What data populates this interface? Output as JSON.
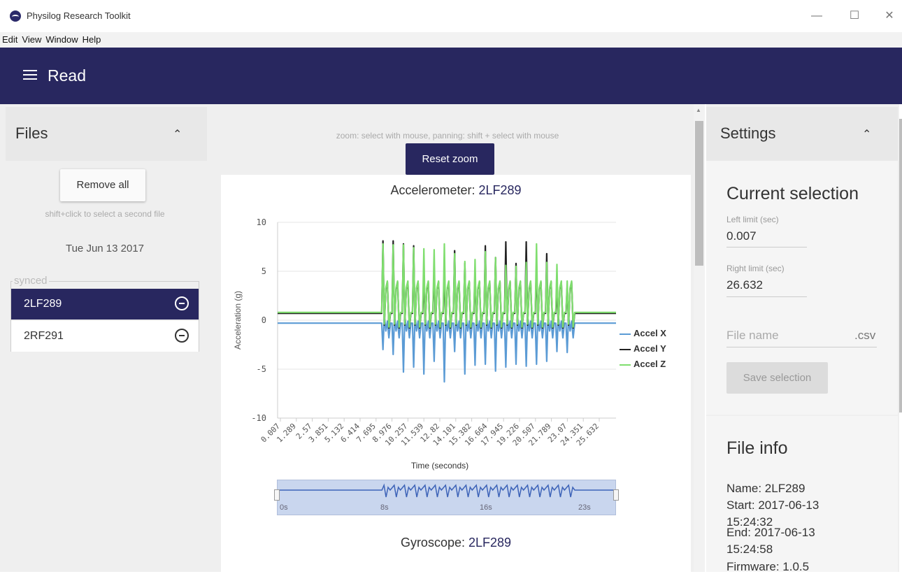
{
  "window": {
    "title": "Physilog Research Toolkit",
    "min": "—",
    "max": "☐",
    "close": "✕"
  },
  "menu": [
    "Edit",
    "View",
    "Window",
    "Help"
  ],
  "appbar": {
    "title": "Read"
  },
  "files": {
    "title": "Files",
    "remove_all": "Remove all",
    "hint": "shift+click to select a second file",
    "date": "Tue Jun 13 2017",
    "group_label": "synced",
    "items": [
      {
        "name": "2LF289"
      },
      {
        "name": "2RF291"
      }
    ]
  },
  "chart_area": {
    "zoom_hint": "zoom: select with mouse, panning: shift + select with mouse",
    "reset_zoom": "Reset zoom",
    "accel_title_a": "Accelerometer: ",
    "accel_title_b": "2LF289",
    "gyro_title_a": "Gyroscope: ",
    "gyro_title_b": "2LF289",
    "navigator_labels": [
      "0s",
      "8s",
      "16s",
      "23s"
    ]
  },
  "chart_data": {
    "type": "line",
    "title": "Accelerometer: 2LF289",
    "xlabel": "Time (seconds)",
    "ylabel": "Acceleration (g)",
    "ylim": [
      -10,
      10
    ],
    "yticks": [
      10,
      5,
      0,
      -5,
      -10
    ],
    "xlim": [
      0.007,
      26.632
    ],
    "xticks": [
      "0.007",
      "1.289",
      "2.57",
      "3.851",
      "5.132",
      "6.414",
      "7.695",
      "8.976",
      "10.257",
      "11.539",
      "12.82",
      "14.101",
      "15.382",
      "16.664",
      "17.945",
      "19.226",
      "20.507",
      "21.789",
      "23.07",
      "24.351",
      "25.632"
    ],
    "series": [
      {
        "name": "Accel X",
        "color": "#5b9bd5",
        "baseline": -0.3,
        "peaks": [
          -3,
          -3.5,
          -5.3,
          -4.8,
          -5.5,
          -4.2,
          -6.3,
          -3.2,
          -5.5,
          -4.6,
          -4.5,
          -5.2,
          -4.8,
          -4.5,
          -4.7,
          -4.5,
          -4.2,
          -3.2,
          -3.3
        ]
      },
      {
        "name": "Accel Y",
        "color": "#222222",
        "baseline": 0.7,
        "peaks": [
          8.1,
          8.1,
          7.8,
          7.6,
          4.6,
          5.5,
          5.4,
          7.1,
          5.8,
          4.9,
          7.6,
          6.4,
          8.0,
          5.8,
          8.0,
          5.9,
          6.8,
          3.5,
          3.5
        ]
      },
      {
        "name": "Accel Z",
        "color": "#7fde6e",
        "baseline": 0.8,
        "peaks": [
          7.8,
          7.7,
          7.7,
          7.4,
          7.3,
          7.2,
          7.8,
          6.8,
          6.0,
          6.2,
          7.0,
          6.4,
          5.6,
          5.5,
          5.9,
          7.8,
          5.9,
          5.7,
          4.0
        ]
      }
    ],
    "activity_range": [
      8.2,
      23.5
    ],
    "legend": "right"
  },
  "settings": {
    "title": "Settings",
    "current_selection": "Current selection",
    "left_label": "Left limit (sec)",
    "left_value": "0.007",
    "right_label": "Right limit (sec)",
    "right_value": "26.632",
    "file_name_placeholder": "File name",
    "ext": ".csv",
    "save": "Save selection",
    "file_info_title": "File info",
    "info_lines": [
      "Name: 2LF289",
      "Start: 2017-06-13",
      "15:24:32",
      "End: 2017-06-13",
      "15:24:58",
      "Firmware: 1.0.5"
    ]
  }
}
